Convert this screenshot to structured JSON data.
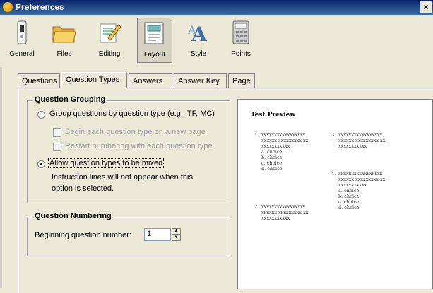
{
  "window": {
    "title": "Preferences",
    "close_glyph": "×"
  },
  "toolbar": {
    "items": [
      {
        "label": "General",
        "icon": "switch-icon"
      },
      {
        "label": "Files",
        "icon": "folder-icon"
      },
      {
        "label": "Editing",
        "icon": "pencil-icon"
      },
      {
        "label": "Layout",
        "icon": "layout-icon",
        "active": true
      },
      {
        "label": "Style",
        "icon": "font-style-icon"
      },
      {
        "label": "Points",
        "icon": "calculator-icon"
      }
    ]
  },
  "tabs": [
    {
      "label": "Questions"
    },
    {
      "label": "Question Types",
      "active": true
    },
    {
      "label": "Answers"
    },
    {
      "label": "Answer Key"
    },
    {
      "label": "Page"
    }
  ],
  "grouping": {
    "legend": "Question Grouping",
    "option_group_by_type": "Group questions by question type (e.g., TF, MC)",
    "check_new_page": "Begin each question type on a new page",
    "check_restart_numbering": "Restart numbering with each question type",
    "option_mixed": "Allow question types to be mixed",
    "note_line1": "Instruction lines will not appear when this",
    "note_line2": "option is selected.",
    "selected": "mixed"
  },
  "numbering": {
    "legend": "Question Numbering",
    "label": "Beginning question number:",
    "value": "1"
  },
  "preview": {
    "title": "Test Preview",
    "questions": [
      {
        "num": "1.",
        "lines": [
          "xxxxxxxxxxxxxxxxx",
          "xxxxxx xxxxxxxxx xx",
          "xxxxxxxxxxx"
        ],
        "choices": [
          "a.  choice",
          "b.  choice",
          "c.  choice",
          "d.  choice"
        ]
      },
      {
        "num": "2.",
        "lines": [
          "xxxxxxxxxxxxxxxxx",
          "xxxxxx xxxxxxxxx xx",
          "xxxxxxxxxxx"
        ],
        "choices": []
      },
      {
        "num": "3.",
        "lines": [
          "xxxxxxxxxxxxxxxxx",
          "xxxxxx xxxxxxxxx xx",
          "xxxxxxxxxxx"
        ],
        "choices": []
      },
      {
        "num": "4.",
        "lines": [
          "xxxxxxxxxxxxxxxxx",
          "xxxxxx xxxxxxxxx xx",
          "xxxxxxxxxxx"
        ],
        "choices": [
          "a.  choice",
          "b.  choice",
          "c.  choice",
          "d.  choice"
        ]
      }
    ]
  }
}
